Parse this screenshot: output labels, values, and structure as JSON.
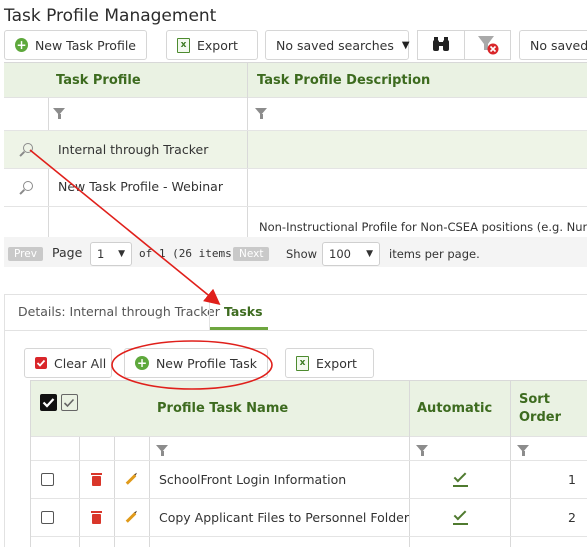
{
  "page": {
    "title": "Task Profile Management"
  },
  "toolbar": {
    "new_task_profile_label": "New Task Profile",
    "export_label": "Export",
    "saved_searches_value": "No saved searches",
    "saved_value_right": "No saved"
  },
  "profiles_grid": {
    "columns": [
      "Task Profile",
      "Task Profile Description"
    ],
    "rows": [
      {
        "name": "Internal through Tracker",
        "description": ""
      },
      {
        "name": "New Task Profile - Webinar",
        "description": ""
      },
      {
        "name": "",
        "description": "Non-Instructional Profile for Non-CSEA positions (e.g. Nurs"
      }
    ]
  },
  "pager": {
    "prev_label": "Prev",
    "page_label": "Page",
    "page_value": "1",
    "of_text": "of 1 (26 items)",
    "next_label": "Next",
    "show_label": "Show",
    "per_page_value": "100",
    "items_per_page_label": "items per page."
  },
  "tabs": [
    {
      "label": "Details: Internal through Tracker",
      "active": false
    },
    {
      "label": "Tasks",
      "active": true
    }
  ],
  "tasks_toolbar": {
    "clear_all_label": "Clear All",
    "new_profile_task_label": "New Profile Task",
    "export_label": "Export"
  },
  "tasks_grid": {
    "columns": [
      "Profile Task Name",
      "Automatic",
      "Sort Order"
    ],
    "rows": [
      {
        "name": "SchoolFront Login Information",
        "automatic": true,
        "sort_order": "1"
      },
      {
        "name": "Copy Applicant Files to Personnel Folder",
        "automatic": true,
        "sort_order": "2"
      }
    ]
  },
  "colors": {
    "accent_green": "#3d6b1f",
    "header_bg": "#eaf2e3",
    "selected_row_bg": "#eef4e7",
    "annotation_red": "#e0201b"
  }
}
